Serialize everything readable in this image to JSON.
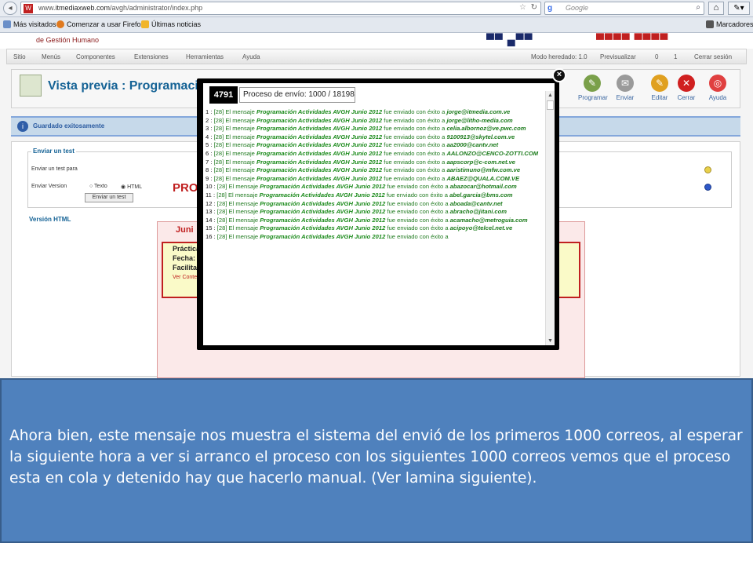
{
  "browser": {
    "url_prefix": "www.",
    "url_domain": "itmediaxweb.com",
    "url_path": "/avgh/administrator/index.php",
    "search_placeholder": "Google",
    "bookmarks": [
      "Más visitados",
      "Comenzar a usar Firefox",
      "Últimas noticias"
    ],
    "bookmarks_right": "Marcadores"
  },
  "admin": {
    "logo_sub": "de Gestión Humano",
    "menu": [
      "Sitio",
      "Menús",
      "Componentes",
      "Extensiones",
      "Herramientas",
      "Ayuda"
    ],
    "menu_right": [
      "Modo heredado: 1.0",
      "Previsualizar",
      "0",
      "1",
      "Cerrar sesión"
    ],
    "page_title": "Vista previa : Programació",
    "tools": [
      "Programar",
      "Enviar",
      "Editar",
      "Cerrar",
      "Ayuda"
    ],
    "message": "Guardado exitosamente",
    "send_test_legend": "Enviar un test",
    "send_test_to": "Enviar un test para",
    "send_version": "Enviar Version",
    "opt_text": "Texto",
    "opt_html": "HTML",
    "send_test_button": "Enviar un test",
    "html_version_legend": "Versión HTML",
    "preview_pro": "PRO",
    "preview_jun": "Juni",
    "preview_labels": [
      "Práctica",
      "Fecha:",
      "Facilita"
    ],
    "preview_link": "Ver Contenido"
  },
  "modal": {
    "counter": "4791",
    "progress": "Proceso de envío: 1000 / 18198",
    "prefix": "[28] El mensaje",
    "subject": "Programación Actividades AVGH Junio 2012",
    "middle": "fue enviado con éxito a",
    "entries": [
      {
        "n": "1",
        "email": "jorge@itmedia.com.ve"
      },
      {
        "n": "2",
        "email": "jorge@litho-media.com"
      },
      {
        "n": "3",
        "email": "celia.albornoz@ve.pwc.com"
      },
      {
        "n": "4",
        "email": "9100913@skytel.com.ve"
      },
      {
        "n": "5",
        "email": "aa2000@cantv.net"
      },
      {
        "n": "6",
        "email": "AALONZO@CENCO-ZOTTI.COM"
      },
      {
        "n": "7",
        "email": "aapscorp@c-com.net.ve"
      },
      {
        "n": "8",
        "email": "aaristimuno@mfw.com.ve"
      },
      {
        "n": "9",
        "email": "ABAEZ@QUALA.COM.VE"
      },
      {
        "n": "10",
        "email": "abazocar@hotmail.com"
      },
      {
        "n": "11",
        "email": "abel.garcia@bms.com"
      },
      {
        "n": "12",
        "email": "aboada@cantv.net"
      },
      {
        "n": "13",
        "email": "abracho@jitani.com"
      },
      {
        "n": "14",
        "email": "acamacho@metroguia.com"
      },
      {
        "n": "15",
        "email": "acipoyo@telcel.net.ve"
      },
      {
        "n": "16",
        "email": ""
      }
    ]
  },
  "caption": {
    "text": "Ahora bien, este mensaje nos muestra el sistema del envió de los primeros 1000 correos, al esperar la siguiente hora a ver si arranco el proceso con los siguientes 1000 correos vemos que el proceso esta en cola y detenido hay que hacerlo manual. (Ver lamina siguiente)."
  }
}
